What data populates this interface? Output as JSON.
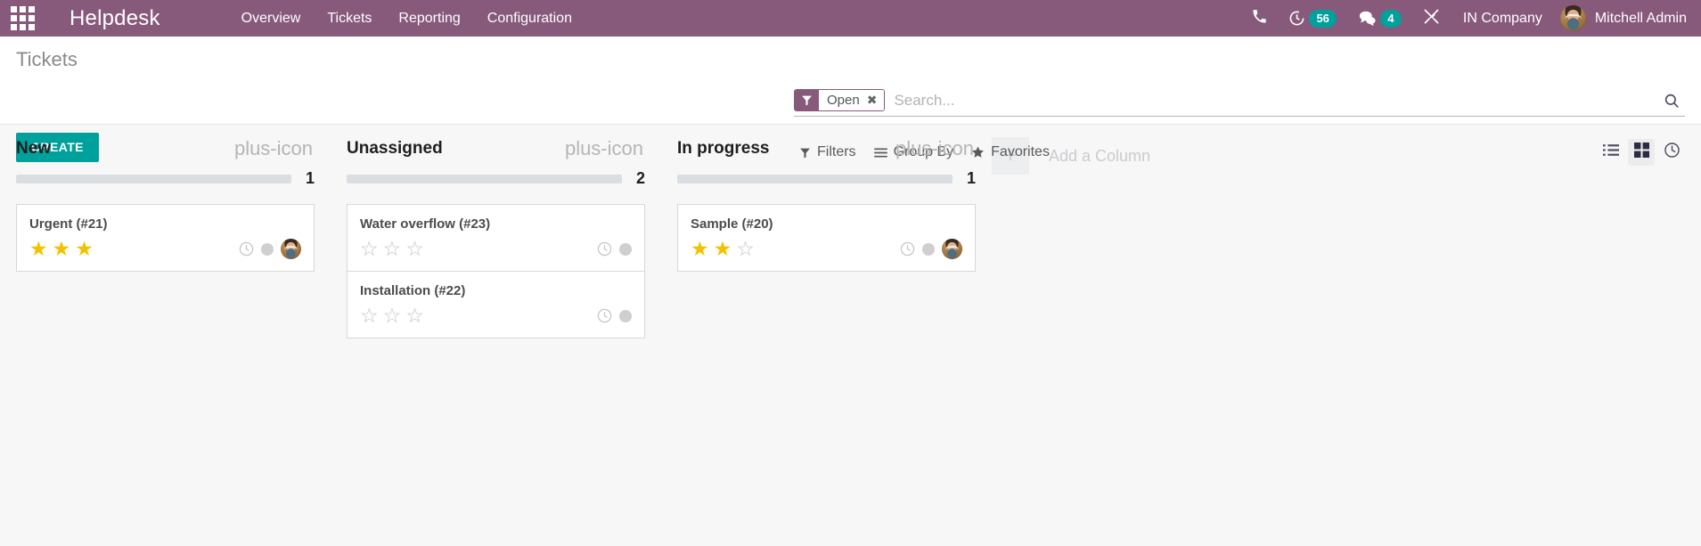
{
  "navbar": {
    "apps_icon": "apps-grid-icon",
    "brand": "Helpdesk",
    "menu": [
      {
        "label": "Overview"
      },
      {
        "label": "Tickets"
      },
      {
        "label": "Reporting"
      },
      {
        "label": "Configuration"
      }
    ],
    "sys_items": [
      {
        "icon": "phone-icon",
        "badge": null
      },
      {
        "icon": "activity-clock-icon",
        "badge": "56"
      },
      {
        "icon": "messages-icon",
        "badge": "4"
      },
      {
        "icon": "debug-tools-icon",
        "badge": null
      }
    ],
    "company": "IN Company",
    "user": "Mitchell Admin",
    "colors": {
      "brand_purple": "#875a7b",
      "badge_teal": "#00a09d"
    }
  },
  "control_panel": {
    "title": "Tickets",
    "create_label": "CREATE",
    "search": {
      "facet": {
        "icon": "filter-funnel-icon",
        "label": "Open",
        "close": "✖"
      },
      "placeholder": "Search...",
      "value": "",
      "magnifier_icon": "search-icon"
    },
    "filter_buttons": [
      {
        "icon": "filter-funnel-icon",
        "label": "Filters"
      },
      {
        "icon": "group-by-lines-icon",
        "label": "Group By"
      },
      {
        "icon": "favorites-star-icon",
        "label": "Favorites"
      }
    ],
    "views": [
      {
        "icon": "list-view-icon",
        "name": "list",
        "active": false
      },
      {
        "icon": "kanban-view-icon",
        "name": "kanban",
        "active": true
      },
      {
        "icon": "activity-view-icon",
        "name": "activity",
        "active": false
      }
    ]
  },
  "kanban": {
    "add_column": {
      "plus": "+",
      "label": "Add a Column"
    },
    "columns": [
      {
        "title": "New",
        "count": "1",
        "add_icon": "plus-icon",
        "cards": [
          {
            "title": "Urgent (#21)",
            "stars_filled": 3,
            "stars_total": 3,
            "has_clock": true,
            "has_status_dot": true,
            "has_avatar": true
          }
        ]
      },
      {
        "title": "Unassigned",
        "count": "2",
        "add_icon": "plus-icon",
        "cards": [
          {
            "title": "Water overflow (#23)",
            "stars_filled": 0,
            "stars_total": 3,
            "has_clock": true,
            "has_status_dot": true,
            "has_avatar": false
          },
          {
            "title": "Installation (#22)",
            "stars_filled": 0,
            "stars_total": 3,
            "has_clock": true,
            "has_status_dot": true,
            "has_avatar": false
          }
        ]
      },
      {
        "title": "In progress",
        "count": "1",
        "add_icon": "plus-icon",
        "cards": [
          {
            "title": "Sample (#20)",
            "stars_filled": 2,
            "stars_total": 3,
            "has_clock": true,
            "has_status_dot": true,
            "has_avatar": true
          }
        ]
      }
    ]
  }
}
